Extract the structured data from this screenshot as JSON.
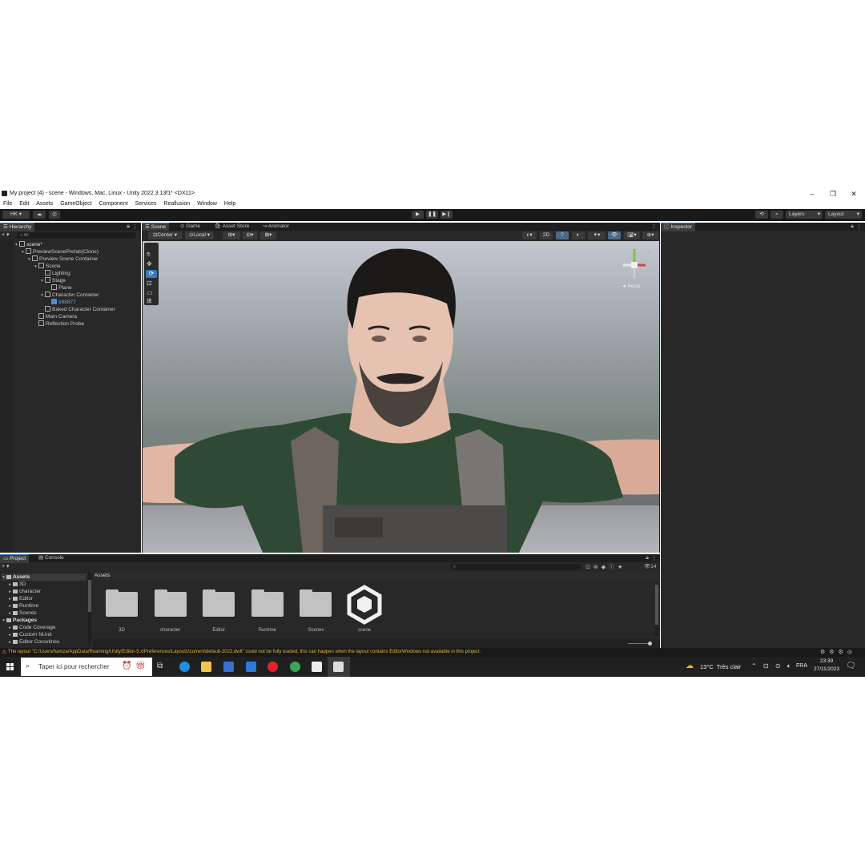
{
  "window": {
    "title": "My project (4) - scene - Windows, Mac, Linux - Unity 2022.3.13f1* <DX11>",
    "minimize": "–",
    "restore": "❐",
    "close": "✕"
  },
  "menu": [
    "File",
    "Edit",
    "Assets",
    "GameObject",
    "Component",
    "Services",
    "Reallusion",
    "Window",
    "Help"
  ],
  "toolbar": {
    "account": "HK",
    "layers": "Layers",
    "layout": "Layout"
  },
  "hierarchy": {
    "tab": "Hierarchy",
    "search_placeholder": "All",
    "items": [
      {
        "label": "scene*",
        "depth": 0
      },
      {
        "label": "PreviewScenePrefab(Clone)",
        "depth": 1
      },
      {
        "label": "Preview Scene Container",
        "depth": 2
      },
      {
        "label": "Scene",
        "depth": 3
      },
      {
        "label": "Lighting",
        "depth": 4
      },
      {
        "label": "Stage",
        "depth": 4
      },
      {
        "label": "Plane",
        "depth": 5
      },
      {
        "label": "Character Container",
        "depth": 4
      },
      {
        "label": "998877",
        "depth": 5
      },
      {
        "label": "Baked Character Container",
        "depth": 4
      },
      {
        "label": "Main Camera",
        "depth": 3
      },
      {
        "label": "Reflection Probe",
        "depth": 3
      }
    ]
  },
  "scene_tabs": [
    "Scene",
    "Game",
    "Asset Store",
    "Animator"
  ],
  "scene_toolbar": {
    "pivot": "Center",
    "space": "Local",
    "mode2d": "2D"
  },
  "gizmo": {
    "persp": "◄ Persp"
  },
  "inspector": {
    "tab": "Inspector"
  },
  "project": {
    "tabs": [
      "Project",
      "Console"
    ],
    "assets_header": "Assets",
    "count": "14",
    "tree": [
      {
        "label": "Assets",
        "depth": 0,
        "bold": true
      },
      {
        "label": "3D",
        "depth": 1
      },
      {
        "label": "character",
        "depth": 1
      },
      {
        "label": "Editor",
        "depth": 1
      },
      {
        "label": "Runtime",
        "depth": 1
      },
      {
        "label": "Scenes",
        "depth": 1
      },
      {
        "label": "Packages",
        "depth": 0,
        "bold": true
      },
      {
        "label": "Code Coverage",
        "depth": 1
      },
      {
        "label": "Custom NUnit",
        "depth": 1
      },
      {
        "label": "Editor Coroutines",
        "depth": 1
      }
    ],
    "grid": [
      "3D",
      "character",
      "Editor",
      "Runtime",
      "Scenes",
      "scene"
    ]
  },
  "status": {
    "warning": "The layout \"C:/Users/hamza/AppData/Roaming/Unity/Editor-5.x/Preferences\\Layouts\\current\\default-2022.dwlt\" could not be fully loaded, this can happen when the layout contains EditorWindows not available in this project."
  },
  "taskbar": {
    "search_placeholder": "Taper ici pour rechercher",
    "weather": "13°C  Très clair",
    "lang": "FRA",
    "time": "23:39",
    "date": "27/11/2023"
  },
  "colors": {
    "accent": "#3a79bb",
    "warning": "#e3b341",
    "panel": "#282828"
  }
}
